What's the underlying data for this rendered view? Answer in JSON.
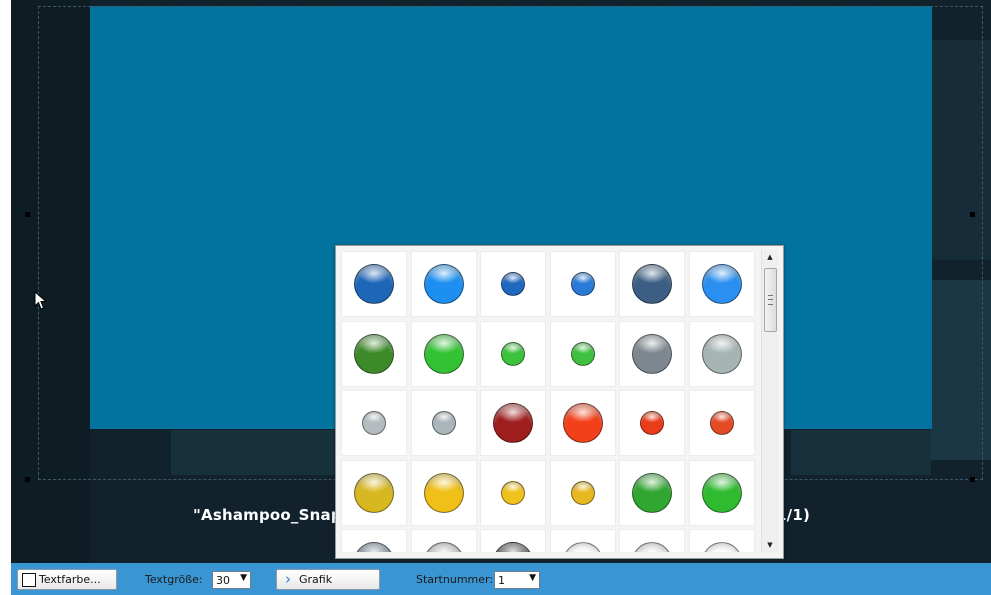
{
  "caption": "\"Ashampoo_Snap_                                                                                  1/1)",
  "caption_left": "\"Ashampoo_Snap_",
  "caption_right": "1/1)",
  "colors": {
    "canvas": "#02729e",
    "background": "#11222c",
    "toolbar": "#3a95d3"
  },
  "picker": {
    "scroll_up_icon": "▲",
    "scroll_down_icon": "▼",
    "rows": [
      [
        {
          "color": "#1e66b8",
          "size": "large"
        },
        {
          "color": "#1c8ff0",
          "size": "large"
        },
        {
          "color": "#2068c0",
          "size": "small"
        },
        {
          "color": "#2a7ad8",
          "size": "small"
        },
        {
          "color": "#3c5e84",
          "size": "large"
        },
        {
          "color": "#2a8ff0",
          "size": "large"
        }
      ],
      [
        {
          "color": "#3d8a2a",
          "size": "large"
        },
        {
          "color": "#33c233",
          "size": "large"
        },
        {
          "color": "#3cc23c",
          "size": "small"
        },
        {
          "color": "#40c040",
          "size": "small"
        },
        {
          "color": "#7d8790",
          "size": "large"
        },
        {
          "color": "#a7b4b4",
          "size": "large"
        }
      ],
      [
        {
          "color": "#b4bcc0",
          "size": "small"
        },
        {
          "color": "#a9b5ba",
          "size": "small"
        },
        {
          "color": "#9e1e1e",
          "size": "large"
        },
        {
          "color": "#f2401a",
          "size": "large"
        },
        {
          "color": "#ea3b1a",
          "size": "small"
        },
        {
          "color": "#e54a26",
          "size": "small"
        }
      ],
      [
        {
          "color": "#d8b820",
          "size": "large"
        },
        {
          "color": "#f0c018",
          "size": "large"
        },
        {
          "color": "#f0c21e",
          "size": "small"
        },
        {
          "color": "#e8b820",
          "size": "small"
        },
        {
          "color": "#31a631",
          "size": "large"
        },
        {
          "color": "#2fba2f",
          "size": "large"
        }
      ],
      [
        {
          "color": "#6f7f94",
          "size": "large"
        },
        {
          "color": "#c0c0c0",
          "size": "large"
        },
        {
          "color": "#444444",
          "size": "large"
        },
        {
          "color": "#ffffff",
          "size": "large"
        },
        {
          "color": "#e8e8e8",
          "size": "large"
        },
        {
          "color": "#ffffff",
          "size": "large"
        }
      ]
    ]
  },
  "toolbar": {
    "text_color_label": "Textfarbe...",
    "text_size_label": "Textgröße:",
    "text_size_value": "30",
    "graphic_label": "Grafik",
    "graphic_icon": "chevron-right-icon",
    "start_number_label": "Startnummer:",
    "start_number_value": "1",
    "dropdown_icon": "▼",
    "chevron_icon": "›"
  }
}
